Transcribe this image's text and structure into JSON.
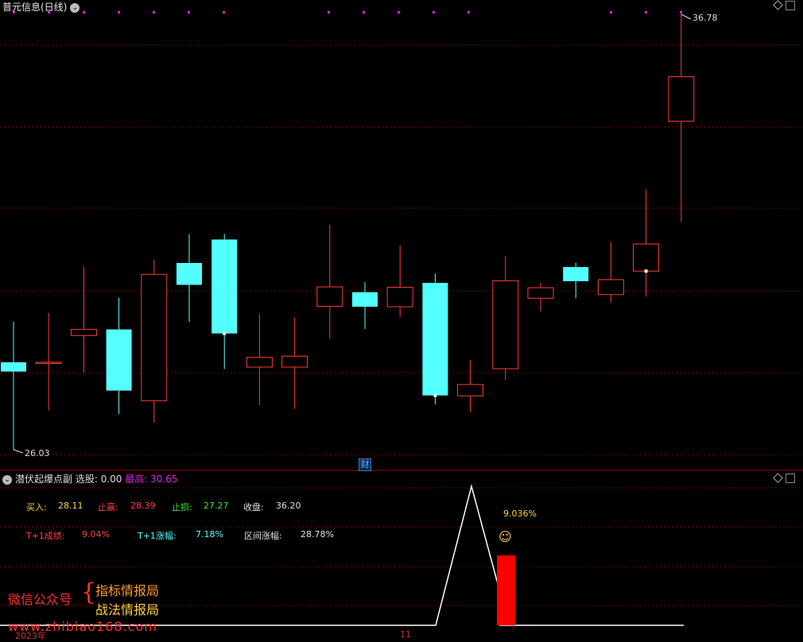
{
  "header": {
    "title": "普元信息(日线)",
    "colors": {
      "up": "#ff3b3b",
      "down": "#54ffff",
      "grid": "#7a0000",
      "magenta": "#e020e0"
    }
  },
  "main_chart": {
    "high_label": "36.78",
    "low_label": "26.03",
    "candles": [
      {
        "o": 28.19,
        "h": 29.19,
        "l": 26.03,
        "c": 27.96
      },
      {
        "o": 28.16,
        "h": 29.41,
        "l": 27.0,
        "c": 28.19
      },
      {
        "o": 28.85,
        "h": 30.55,
        "l": 27.94,
        "c": 29.0
      },
      {
        "o": 29.0,
        "h": 29.78,
        "l": 26.91,
        "c": 27.49
      },
      {
        "o": 27.24,
        "h": 30.72,
        "l": 26.7,
        "c": 30.36
      },
      {
        "o": 30.64,
        "h": 31.35,
        "l": 29.18,
        "c": 30.1
      },
      {
        "o": 31.22,
        "h": 31.36,
        "l": 28.02,
        "c": 28.9
      },
      {
        "o": 28.07,
        "h": 29.38,
        "l": 27.13,
        "c": 28.31
      },
      {
        "o": 28.07,
        "h": 29.29,
        "l": 27.04,
        "c": 28.34
      },
      {
        "o": 29.57,
        "h": 31.58,
        "l": 28.77,
        "c": 30.05
      },
      {
        "o": 29.92,
        "h": 30.17,
        "l": 29.01,
        "c": 29.56
      },
      {
        "o": 29.56,
        "h": 31.07,
        "l": 29.31,
        "c": 30.04
      },
      {
        "o": 30.15,
        "h": 30.38,
        "l": 27.15,
        "c": 27.37
      },
      {
        "o": 27.36,
        "h": 28.24,
        "l": 26.96,
        "c": 27.64
      },
      {
        "o": 28.03,
        "h": 30.81,
        "l": 27.75,
        "c": 30.2
      },
      {
        "o": 29.77,
        "h": 30.15,
        "l": 29.45,
        "c": 30.03
      },
      {
        "o": 30.54,
        "h": 30.65,
        "l": 29.77,
        "c": 30.19
      },
      {
        "o": 29.86,
        "h": 31.15,
        "l": 29.66,
        "c": 30.23
      },
      {
        "o": 30.44,
        "h": 32.46,
        "l": 29.81,
        "c": 31.11
      },
      {
        "o": 34.14,
        "h": 36.78,
        "l": 31.66,
        "c": 35.24
      }
    ]
  },
  "sub_chart": {
    "indicator_name": "潜伏起爆点副",
    "select_label": "选股: ",
    "select_value": "0.00",
    "max_label": "最高: ",
    "max_value": "30.65",
    "buy_label": "买入:",
    "buy_value": "28.11",
    "tp_label": "止赢:",
    "tp_value": "28.39",
    "sl_label": "止损:",
    "sl_value": "27.27",
    "close_label": "收盘:",
    "close_value": "36.20",
    "t1_result_label": "T+1成绩:",
    "t1_result_value": "9.04%",
    "t1_gain_label": "T+1涨幅:",
    "t1_gain_value": "7.18%",
    "range_label": "区间涨幅:",
    "range_value": "28.78%",
    "peak_pct": "9.036%",
    "smiley": "☺",
    "wechat_label": "微信公众号",
    "brace": "{",
    "account1": "指标情报局",
    "account2": "战法情报局",
    "watermark": "www.zhibiao168.com",
    "cai_badge": "财",
    "year_label": "2023年",
    "month_label": "11"
  }
}
